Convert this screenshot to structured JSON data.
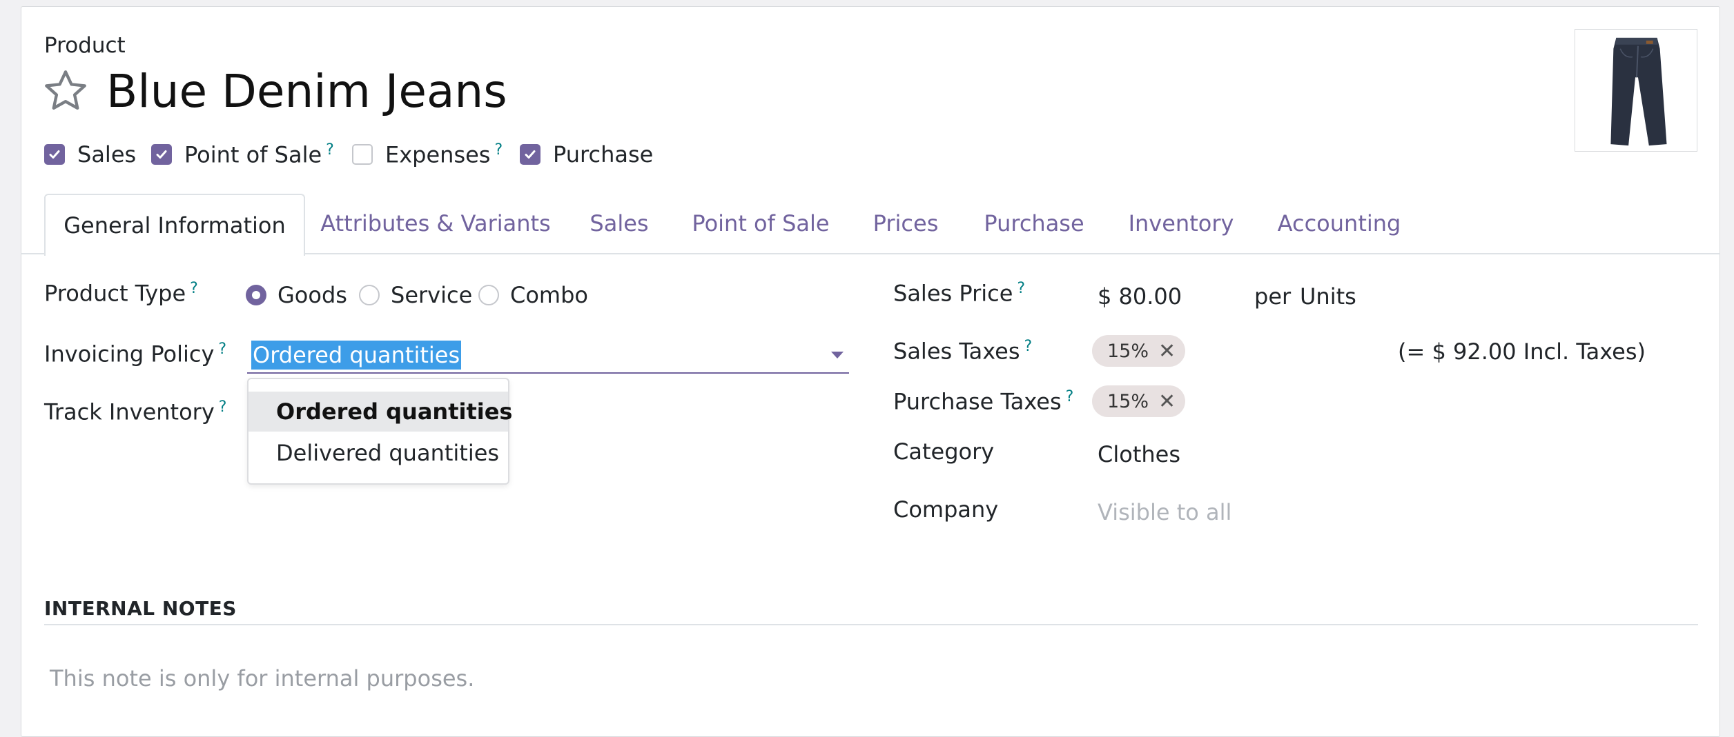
{
  "breadcrumb": {
    "label": "Product"
  },
  "product": {
    "name": "Blue Denim Jeans"
  },
  "options": [
    {
      "label": "Sales",
      "checked": true,
      "help": ""
    },
    {
      "label": "Point of Sale",
      "checked": true,
      "help": "?"
    },
    {
      "label": "Expenses",
      "checked": false,
      "help": "?"
    },
    {
      "label": "Purchase",
      "checked": true,
      "help": ""
    }
  ],
  "tabs": [
    {
      "label": "General Information",
      "active": true
    },
    {
      "label": "Attributes & Variants"
    },
    {
      "label": "Sales"
    },
    {
      "label": "Point of Sale"
    },
    {
      "label": "Prices"
    },
    {
      "label": "Purchase"
    },
    {
      "label": "Inventory"
    },
    {
      "label": "Accounting"
    }
  ],
  "left_fields": {
    "product_type": {
      "label": "Product Type",
      "help": "?",
      "options": [
        "Goods",
        "Service",
        "Combo"
      ],
      "selected": "Goods"
    },
    "invoicing_policy": {
      "label": "Invoicing Policy",
      "help": "?",
      "value": "Ordered quantities",
      "dropdown": [
        "Ordered quantities",
        "Delivered quantities"
      ]
    },
    "track_inventory": {
      "label": "Track Inventory",
      "help": "?"
    }
  },
  "right_fields": {
    "sales_price": {
      "label": "Sales Price",
      "help": "?",
      "value": "$ 80.00",
      "per": "per",
      "unit": "Units"
    },
    "sales_taxes": {
      "label": "Sales Taxes",
      "help": "?",
      "tag": "15%",
      "incl": "(= $ 92.00 Incl. Taxes)"
    },
    "purchase_taxes": {
      "label": "Purchase Taxes",
      "help": "?",
      "tag": "15%"
    },
    "category": {
      "label": "Category",
      "value": "Clothes"
    },
    "company": {
      "label": "Company",
      "placeholder": "Visible to all"
    }
  },
  "internal_notes": {
    "title": "INTERNAL NOTES",
    "placeholder": "This note is only for internal purposes."
  },
  "colors": {
    "accent": "#71639e",
    "help": "#017e84",
    "selection": "#3d9de8"
  }
}
